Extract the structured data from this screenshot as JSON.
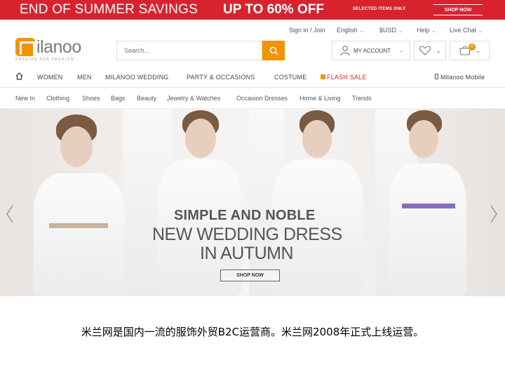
{
  "promo": {
    "headline": "END OF SUMMER SAVINGS",
    "offer": "UP TO 60% OFF",
    "note": "SELECTED ITEMS ONLY",
    "cta": "SHOP NOW",
    "bg_color": "#d8232f"
  },
  "utility": {
    "signin": "Sign in / Join",
    "language": "English",
    "currency": "$USD",
    "help": "Help",
    "live_chat": "Live Chat"
  },
  "brand": {
    "name": "Milanoo",
    "wordmark": "ilanoo",
    "tagline": "PASSION FOR FASHION",
    "accent_color": "#f29300"
  },
  "search": {
    "placeholder": "Search...",
    "icon": "search-icon"
  },
  "account": {
    "label": "MY ACCOUNT",
    "icon": "user-icon"
  },
  "wishlist": {
    "icon": "heart-icon"
  },
  "cart": {
    "icon": "cart-icon",
    "count": "0"
  },
  "nav": {
    "home_icon": "home-icon",
    "items": [
      "WOMEN",
      "MEN",
      "MILANOO WEDDING",
      "PARTY & OCCASIONS",
      "COSTUME",
      "FLASH SALE"
    ],
    "mobile": "Milanoo Mobile"
  },
  "subnav": {
    "items": [
      "New In",
      "Clothing",
      "Shoes",
      "Bags",
      "Beauty",
      "Jewelry & Watches",
      "Occasion Dresses",
      "Home & Living",
      "Trends"
    ]
  },
  "hero": {
    "line1": "SIMPLE AND NOBLE",
    "line2": "NEW WEDDING DRESS",
    "line3": "IN AUTUMN",
    "cta": "SHOP NOW"
  },
  "caption": "米兰网是国内一流的服饰外贸B2C运营商。米兰网2008年正式上线运营。"
}
